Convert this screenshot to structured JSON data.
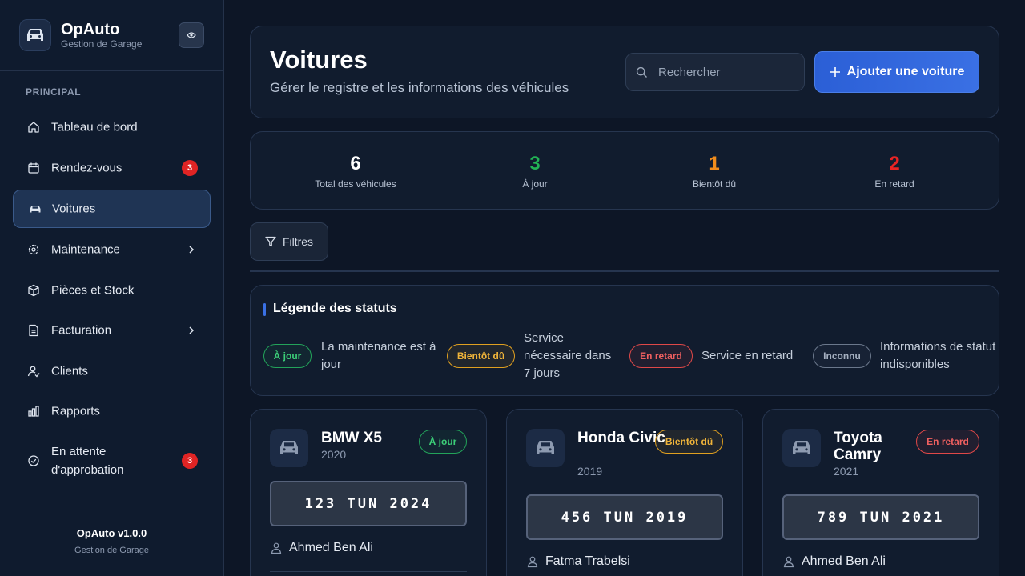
{
  "brand": {
    "title": "OpAuto",
    "subtitle": "Gestion de Garage"
  },
  "sidebar": {
    "section_label": "PRINCIPAL",
    "items": [
      {
        "label": "Tableau de bord",
        "icon": "home-icon"
      },
      {
        "label": "Rendez-vous",
        "icon": "calendar-icon",
        "badge": "3"
      },
      {
        "label": "Voitures",
        "icon": "car-icon",
        "active": true
      },
      {
        "label": "Maintenance",
        "icon": "gear-icon",
        "has_submenu": true
      },
      {
        "label": "Pièces et Stock",
        "icon": "box-icon"
      },
      {
        "label": "Facturation",
        "icon": "document-icon",
        "has_submenu": true
      },
      {
        "label": "Clients",
        "icon": "user-icon"
      },
      {
        "label": "Rapports",
        "icon": "bar-chart-icon"
      },
      {
        "label": "En attente d'approbation",
        "icon": "check-circle-icon",
        "badge": "3"
      }
    ],
    "footer": {
      "version": "OpAuto v1.0.0",
      "subtitle": "Gestion de Garage"
    }
  },
  "header": {
    "title": "Voitures",
    "subtitle": "Gérer le registre et les informations des véhicules",
    "search_placeholder": "Rechercher",
    "add_button": "Ajouter une voiture"
  },
  "stats": [
    {
      "value": "6",
      "label": "Total des véhicules",
      "color": "#ffffff"
    },
    {
      "value": "3",
      "label": "À jour",
      "color": "#22b455"
    },
    {
      "value": "1",
      "label": "Bientôt dû",
      "color": "#f08c1c"
    },
    {
      "value": "2",
      "label": "En retard",
      "color": "#e82424"
    }
  ],
  "filters_label": "Filtres",
  "legend": {
    "title": "Légende des statuts",
    "items": [
      {
        "badge": "À jour",
        "description": "La maintenance est à jour"
      },
      {
        "badge": "Bientôt dû",
        "description": "Service nécessaire dans 7 jours"
      },
      {
        "badge": "En retard",
        "description": "Service en retard"
      },
      {
        "badge": "Inconnu",
        "description": "Informations de statut indisponibles"
      }
    ]
  },
  "cars": [
    {
      "name": "BMW X5",
      "year": "2020",
      "status": "À jour",
      "plate": "123 TUN 2024",
      "owner": "Ahmed Ben Ali"
    },
    {
      "name": "Honda Civic",
      "year": "2019",
      "status": "Bientôt dû",
      "plate": "456 TUN 2019",
      "owner": "Fatma Trabelsi"
    },
    {
      "name": "Toyota Camry",
      "year": "2021",
      "status": "En retard",
      "plate": "789 TUN 2021",
      "owner": "Ahmed Ben Ali"
    }
  ]
}
